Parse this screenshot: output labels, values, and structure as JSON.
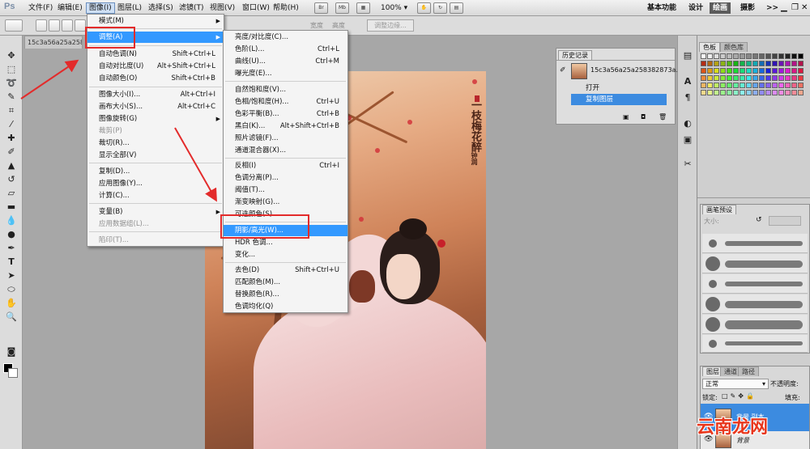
{
  "app": {
    "logo": "Ps"
  },
  "menubar": {
    "items": [
      "文件(F)",
      "编辑(E)",
      "图像(I)",
      "图层(L)",
      "选择(S)",
      "滤镜(T)",
      "视图(V)",
      "窗口(W)",
      "帮助(H)"
    ],
    "active": "图像(I)",
    "toolbar_icons": [
      "Br",
      "Mb"
    ],
    "zoom": "100%",
    "workspaces": [
      "基本功能",
      "设计",
      "绘画",
      "摄影"
    ],
    "active_workspace": "绘画",
    "more": ">>"
  },
  "options_bar": {
    "width_label": "宽度",
    "height_label": "高度",
    "refine_edge_label": "调整边缘..."
  },
  "document": {
    "tab_title": "15c3a56a25a2583"
  },
  "image_menu": {
    "items": [
      {
        "label": "模式(M)",
        "shortcut": "",
        "submenu": true,
        "disabled": false
      },
      {
        "label": "调整(A)",
        "shortcut": "",
        "submenu": true,
        "disabled": false,
        "highlighted": true
      },
      {
        "label": "自动色调(N)",
        "shortcut": "Shift+Ctrl+L",
        "disabled": false
      },
      {
        "label": "自动对比度(U)",
        "shortcut": "Alt+Shift+Ctrl+L",
        "disabled": false
      },
      {
        "label": "自动颜色(O)",
        "shortcut": "Shift+Ctrl+B",
        "disabled": false
      },
      {
        "label": "图像大小(I)...",
        "shortcut": "Alt+Ctrl+I",
        "disabled": false
      },
      {
        "label": "画布大小(S)...",
        "shortcut": "Alt+Ctrl+C",
        "disabled": false
      },
      {
        "label": "图像旋转(G)",
        "shortcut": "",
        "submenu": true,
        "disabled": false
      },
      {
        "label": "裁剪(P)",
        "shortcut": "",
        "disabled": true
      },
      {
        "label": "裁切(R)...",
        "shortcut": "",
        "disabled": false
      },
      {
        "label": "显示全部(V)",
        "shortcut": "",
        "disabled": false
      },
      {
        "label": "复制(D)...",
        "shortcut": "",
        "disabled": false
      },
      {
        "label": "应用图像(Y)...",
        "shortcut": "",
        "disabled": false
      },
      {
        "label": "计算(C)...",
        "shortcut": "",
        "disabled": false
      },
      {
        "label": "变量(B)",
        "shortcut": "",
        "submenu": true,
        "disabled": false
      },
      {
        "label": "应用数据组(L)...",
        "shortcut": "",
        "disabled": true
      },
      {
        "label": "陷印(T)...",
        "shortcut": "",
        "disabled": true
      }
    ]
  },
  "adjust_submenu": {
    "items": [
      {
        "label": "亮度/对比度(C)...",
        "shortcut": ""
      },
      {
        "label": "色阶(L)...",
        "shortcut": "Ctrl+L"
      },
      {
        "label": "曲线(U)...",
        "shortcut": "Ctrl+M"
      },
      {
        "label": "曝光度(E)...",
        "shortcut": ""
      },
      {
        "label": "自然饱和度(V)...",
        "shortcut": ""
      },
      {
        "label": "色相/饱和度(H)...",
        "shortcut": "Ctrl+U"
      },
      {
        "label": "色彩平衡(B)...",
        "shortcut": "Ctrl+B"
      },
      {
        "label": "黑白(K)...",
        "shortcut": "Alt+Shift+Ctrl+B"
      },
      {
        "label": "照片滤镜(F)...",
        "shortcut": ""
      },
      {
        "label": "通道混合器(X)...",
        "shortcut": ""
      },
      {
        "label": "反相(I)",
        "shortcut": "Ctrl+I"
      },
      {
        "label": "色调分离(P)...",
        "shortcut": ""
      },
      {
        "label": "阈值(T)...",
        "shortcut": ""
      },
      {
        "label": "渐变映射(G)...",
        "shortcut": ""
      },
      {
        "label": "可选颜色(S)...",
        "shortcut": ""
      },
      {
        "label": "阴影/高光(W)...",
        "shortcut": "",
        "highlighted": true
      },
      {
        "label": "HDR 色调...",
        "shortcut": ""
      },
      {
        "label": "变化...",
        "shortcut": ""
      },
      {
        "label": "去色(D)",
        "shortcut": "Shift+Ctrl+U"
      },
      {
        "label": "匹配颜色(M)...",
        "shortcut": ""
      },
      {
        "label": "替换颜色(R)...",
        "shortcut": ""
      },
      {
        "label": "色调均化(Q)",
        "shortcut": ""
      }
    ]
  },
  "history_panel": {
    "tab": "历史记录",
    "snapshot": "15c3a56a25a258382873a...",
    "entries": [
      "打开",
      "复制图层"
    ],
    "selected": "复制图层"
  },
  "color_panel": {
    "tabs": [
      "色板",
      "颜色库"
    ]
  },
  "brush_panel": {
    "tab": "画笔预设",
    "size_label": "大小:"
  },
  "layers_panel": {
    "tabs": [
      "图层",
      "通道",
      "路径"
    ],
    "blend_mode": "正常",
    "opacity_label": "不透明度:",
    "lock_label": "锁定:",
    "fill_label": "填充:",
    "layers": [
      "背景 副本",
      "背景"
    ]
  },
  "canvas_art": {
    "calligraphy": "一枝梅花醉",
    "signature": "钟润"
  },
  "watermark": "云南龙网",
  "colors": {
    "highlight": "#3399ff",
    "annotation_red": "#e32b2b",
    "history_selected": "#3c8be0"
  }
}
